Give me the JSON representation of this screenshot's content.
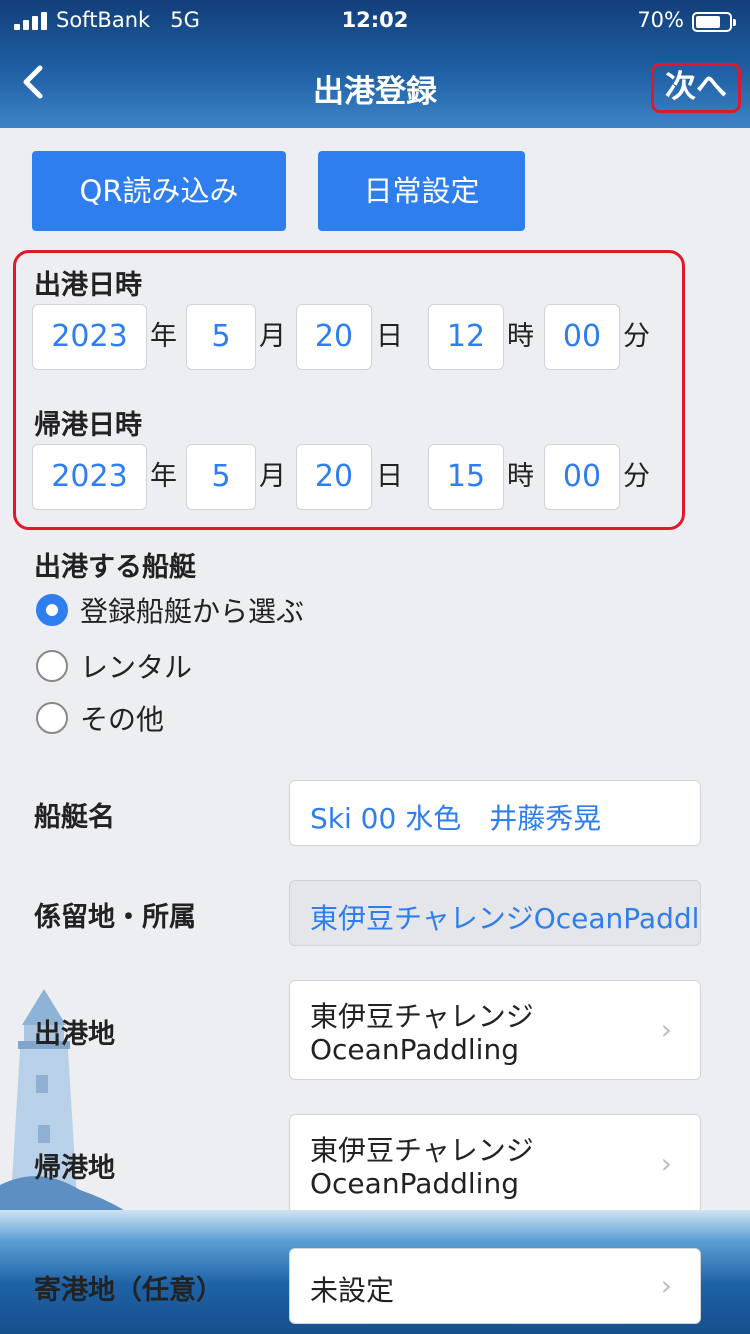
{
  "status_bar": {
    "carrier": "SoftBank",
    "network": "5G",
    "time": "12:02",
    "battery": "70%"
  },
  "nav": {
    "back_icon": "chevron-left-icon",
    "title": "出港登録",
    "next_label": "次へ"
  },
  "buttons": {
    "qr": "QR読み込み",
    "daily": "日常設定"
  },
  "departure": {
    "label": "出港日時",
    "year": "2023",
    "month": "5",
    "day": "20",
    "hour": "12",
    "minute": "00"
  },
  "return": {
    "label": "帰港日時",
    "year": "2023",
    "month": "5",
    "day": "20",
    "hour": "15",
    "minute": "00"
  },
  "units": {
    "year": "年",
    "month": "月",
    "day": "日",
    "hour": "時",
    "minute": "分"
  },
  "boat_section": {
    "label": "出港する船艇",
    "options": [
      "登録船艇から選ぶ",
      "レンタル",
      "その他"
    ],
    "selected_index": 0
  },
  "form": {
    "boat_name": {
      "label": "船艇名",
      "value": "Ski 00 水色　井藤秀晃"
    },
    "mooring": {
      "label": "係留地・所属",
      "value": "東伊豆チャレンジOceanPaddling"
    },
    "departure_port": {
      "label": "出港地",
      "line1": "東伊豆チャレンジ",
      "line2": "OceanPaddling"
    },
    "return_port": {
      "label": "帰港地",
      "line1": "東伊豆チャレンジ",
      "line2": "OceanPaddling"
    },
    "stopover": {
      "label": "寄港地（任意）",
      "value": "未設定"
    }
  },
  "colors": {
    "accent": "#2f7ef0",
    "highlight": "#e0192a",
    "header": "#1f5fa3"
  }
}
